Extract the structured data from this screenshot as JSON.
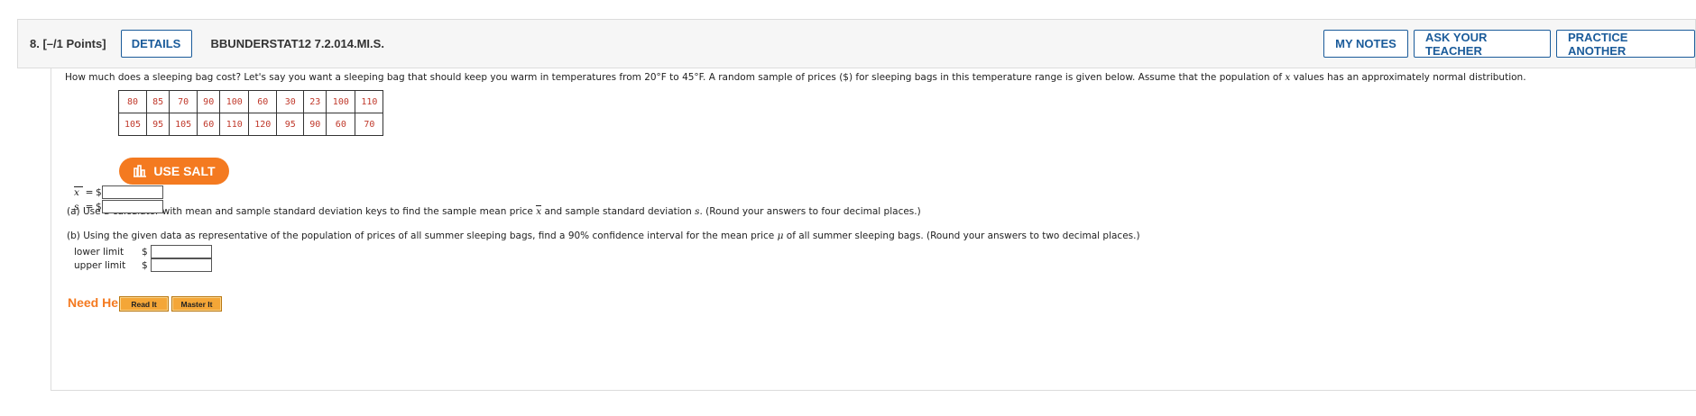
{
  "header": {
    "question_number": "8.  [–/1 Points]",
    "details_label": "DETAILS",
    "question_code": "BBUNDERSTAT12 7.2.014.MI.S.",
    "my_notes_label": "MY NOTES",
    "ask_teacher_label": "ASK YOUR TEACHER",
    "practice_label": "PRACTICE ANOTHER"
  },
  "question": {
    "text_1": "How much does a sleeping bag cost? Let's say you want a sleeping bag that should keep you warm in temperatures from 20°F to 45°F. A random sample of prices ($) for sleeping bags in this temperature range is given below. Assume that the population of ",
    "var_x": "x",
    "text_2": " values has an approximately normal distribution."
  },
  "data_table": {
    "row1": [
      "80",
      "85",
      "70",
      "90",
      "100",
      "60",
      "30",
      "23",
      "100",
      "110"
    ],
    "row2": [
      "105",
      "95",
      "105",
      "60",
      "110",
      "120",
      "95",
      "90",
      "60",
      "70"
    ]
  },
  "salt_button": {
    "label": "USE SALT",
    "color": "#f47a20"
  },
  "part_a": {
    "prefix": "(a)   Use a calculator with mean and sample standard deviation keys to find the sample mean price ",
    "xbar": "x",
    "middle": " and sample standard deviation ",
    "s": "s",
    "suffix": ". (Round your answers to four decimal places.)",
    "xbar_label": "x",
    "s_label": "s",
    "equals": "=",
    "currency": "$",
    "xbar_value": "",
    "s_value": ""
  },
  "part_b": {
    "prefix": "(b)   Using the given data as representative of the population of prices of all summer sleeping bags, find a 90% confidence interval for the mean price ",
    "mu": "μ",
    "suffix": " of all summer sleeping bags. (Round your answers to two decimal places.)",
    "lower_label": "lower limit",
    "upper_label": "upper limit",
    "currency": "$",
    "lower_value": "",
    "upper_value": ""
  },
  "help": {
    "label": "Need Help?",
    "read_it": "Read It",
    "master_it": "Master It"
  },
  "colors": {
    "accent_blue": "#1a5b9a",
    "orange": "#f47a20",
    "data_red": "#c0392b"
  }
}
